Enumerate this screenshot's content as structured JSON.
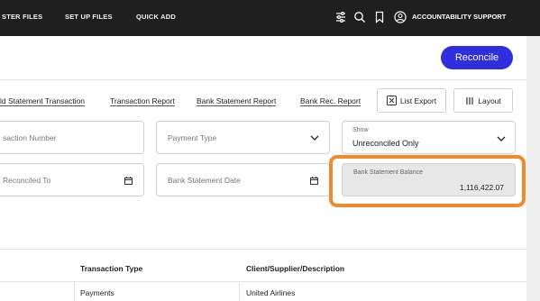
{
  "topbar": {
    "nav": [
      "STER FILES",
      "SET UP FILES",
      "QUICK ADD"
    ],
    "icons": [
      "settings-sliders-icon",
      "search-icon",
      "bookmark-icon",
      "user-circle-icon"
    ],
    "user": "ACCOUNTABILITY SUPPORT"
  },
  "actions": {
    "reconcile": "Reconcile"
  },
  "toolbar": {
    "links": [
      "ld Statement Transaction",
      "Transaction Report",
      "Bank Statement Report",
      "Bank Rec. Report"
    ],
    "list_export": "List Export",
    "layout": "Layout"
  },
  "filters": {
    "transaction_number": "saction Number",
    "payment_type": "Payment Type",
    "show_label": "Show",
    "show_value": "Unreconciled Only",
    "reconciled_to": "Reconciled To",
    "bank_statement_date": "Bank Statement Date",
    "balance_label": "Bank Statement Balance",
    "balance_value": "1,116,422.07"
  },
  "table": {
    "headers": [
      "Transaction Type",
      "Client/Supplier/Description"
    ],
    "rows": [
      [
        "Payments",
        "United Airlines"
      ]
    ]
  },
  "colors": {
    "accent": "#2f2fe0",
    "highlight": "#ef8a2e",
    "topbar": "#1f1f1f"
  }
}
